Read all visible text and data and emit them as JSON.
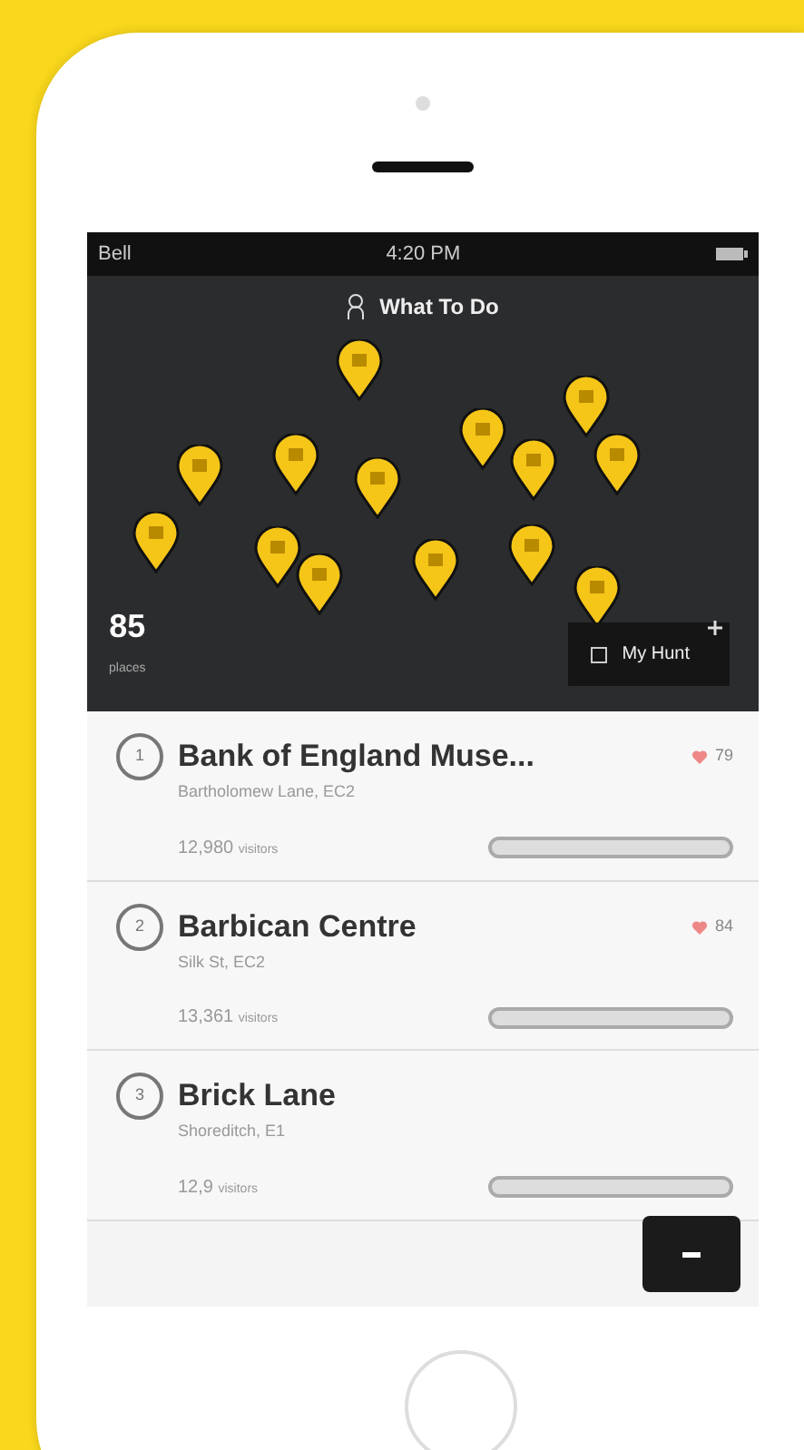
{
  "status_bar": {
    "carrier": "Bell",
    "time": "4:20 PM"
  },
  "map": {
    "title": "What To Do",
    "count": "85",
    "count_label": "places",
    "hunt_button": "My Hunt"
  },
  "places": [
    {
      "rank": "1",
      "name": "Bank of England Muse...",
      "address": "Bartholomew Lane, EC2",
      "likes": "79",
      "visitors": "12,980",
      "visitors_label": "visitors"
    },
    {
      "rank": "2",
      "name": "Barbican Centre",
      "address": "Silk St, EC2",
      "likes": "84",
      "visitors": "13,361",
      "visitors_label": "visitors"
    },
    {
      "rank": "3",
      "name": "Brick Lane",
      "address": "Shoreditch, E1",
      "visitors": "12,9",
      "visitors_label": "visitors"
    }
  ]
}
